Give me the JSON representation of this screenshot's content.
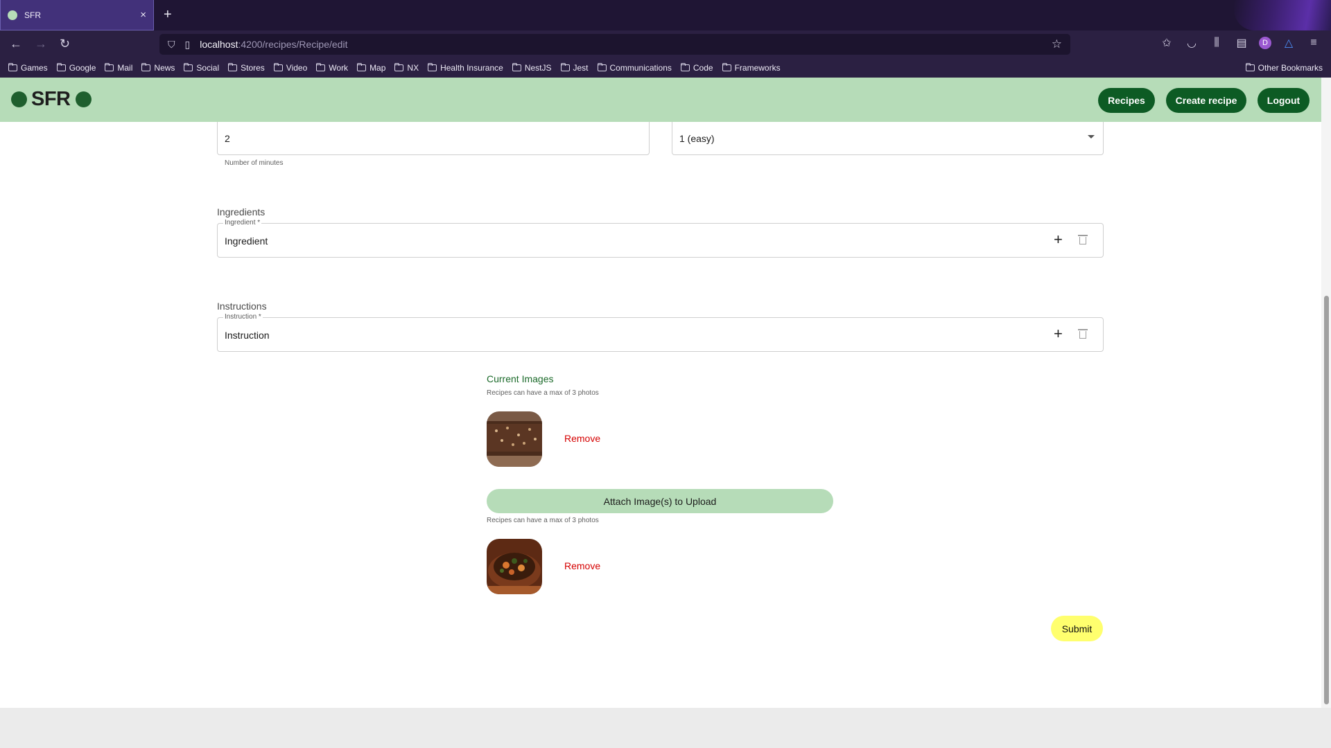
{
  "browser": {
    "tab_title": "SFR",
    "tab_close": "×",
    "new_tab": "+",
    "url_host": "localhost",
    "url_path": ":4200/recipes/Recipe/edit",
    "bookmarks": [
      "Games",
      "Google",
      "Mail",
      "News",
      "Social",
      "Stores",
      "Video",
      "Work",
      "Map",
      "NX",
      "Health Insurance",
      "NestJS",
      "Jest",
      "Communications",
      "Code",
      "Frameworks"
    ],
    "other_bookmarks": "Other Bookmarks",
    "profile_initial": "D"
  },
  "app": {
    "logo_text": "SFR",
    "nav": {
      "recipes": "Recipes",
      "create_recipe": "Create recipe",
      "logout": "Logout"
    },
    "colors": {
      "appbar": "#b6dcb8",
      "nav_button": "#0d5b24",
      "remove": "#d50000",
      "submit": "#ffff6e"
    }
  },
  "form": {
    "cook_time": {
      "value": "2",
      "hint": "Number of minutes"
    },
    "difficulty": {
      "value": "1 (easy)"
    },
    "ingredients": {
      "section_title": "Ingredients",
      "label": "Ingredient *",
      "value": "Ingredient"
    },
    "instructions": {
      "section_title": "Instructions",
      "label": "Instruction *",
      "value": "Instruction"
    },
    "current_images": {
      "title": "Current Images",
      "hint": "Recipes can have a max of 3 photos",
      "remove_label": "Remove"
    },
    "upload": {
      "button_label": "Attach Image(s) to Upload",
      "hint": "Recipes can have a max of 3 photos",
      "remove_label": "Remove"
    },
    "submit_label": "Submit"
  }
}
